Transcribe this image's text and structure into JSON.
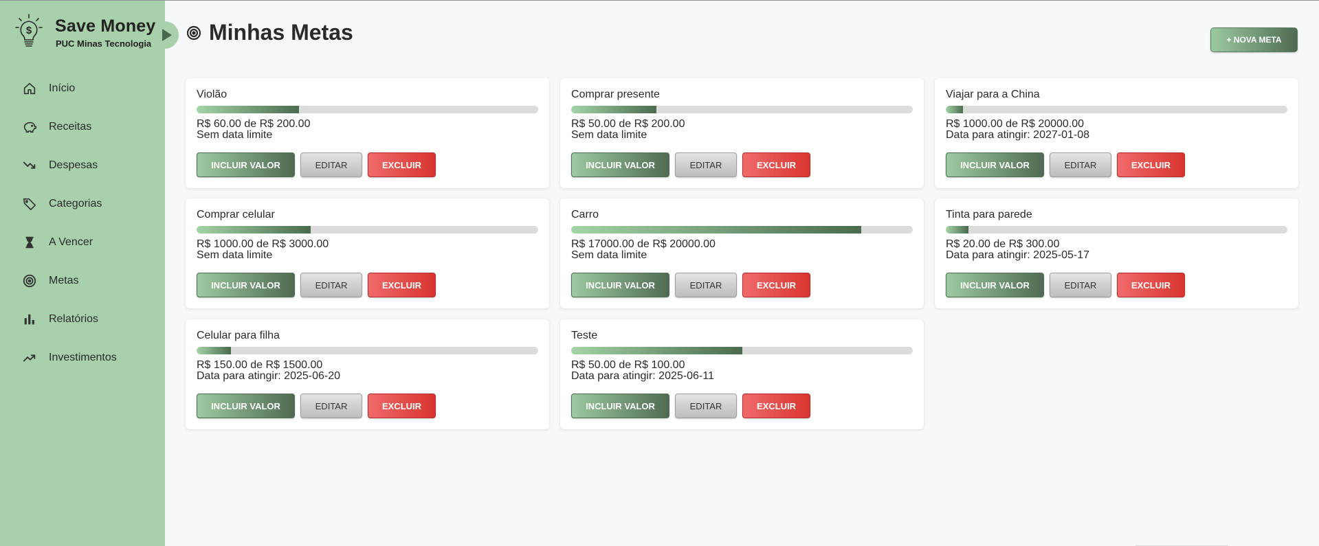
{
  "app": {
    "title": "Save Money",
    "subtitle": "PUC Minas Tecnologia",
    "brand_color": "#a7d0ab",
    "accent_color": "#4f6b53"
  },
  "sidebar": {
    "items": [
      {
        "label": "Início",
        "icon": "home-icon"
      },
      {
        "label": "Receitas",
        "icon": "piggy-bank-icon"
      },
      {
        "label": "Despesas",
        "icon": "trending-down-icon"
      },
      {
        "label": "Categorias",
        "icon": "tag-icon"
      },
      {
        "label": "A Vencer",
        "icon": "hourglass-icon"
      },
      {
        "label": "Metas",
        "icon": "target-icon"
      },
      {
        "label": "Relatórios",
        "icon": "bar-chart-icon"
      },
      {
        "label": "Investimentos",
        "icon": "trending-up-icon"
      }
    ]
  },
  "header": {
    "title": "Minhas Metas",
    "new_button": "+ NOVA META"
  },
  "buttons": {
    "add": "INCLUIR VALOR",
    "edit": "EDITAR",
    "delete": "EXCLUIR"
  },
  "goals": [
    {
      "name": "Violão",
      "amount": "R$ 60.00 de R$ 200.00",
      "date": "Sem data limite",
      "progress": 0.3
    },
    {
      "name": "Comprar presente",
      "amount": "R$ 50.00 de R$ 200.00",
      "date": "Sem data limite",
      "progress": 0.25
    },
    {
      "name": "Viajar para a China",
      "amount": "R$ 1000.00 de R$ 20000.00",
      "date": "Data para atingir: 2027-01-08",
      "progress": 0.05
    },
    {
      "name": "Comprar celular",
      "amount": "R$ 1000.00 de R$ 3000.00",
      "date": "Sem data limite",
      "progress": 0.3333
    },
    {
      "name": "Carro",
      "amount": "R$ 17000.00 de R$ 20000.00",
      "date": "Sem data limite",
      "progress": 0.85
    },
    {
      "name": "Tinta para parede",
      "amount": "R$ 20.00 de R$ 300.00",
      "date": "Data para atingir: 2025-05-17",
      "progress": 0.0667
    },
    {
      "name": "Celular para filha",
      "amount": "R$ 150.00 de R$ 1500.00",
      "date": "Data para atingir: 2025-06-20",
      "progress": 0.1
    },
    {
      "name": "Teste",
      "amount": "R$ 50.00 de R$ 100.00",
      "date": "Data para atingir: 2025-06-11",
      "progress": 0.5
    }
  ]
}
